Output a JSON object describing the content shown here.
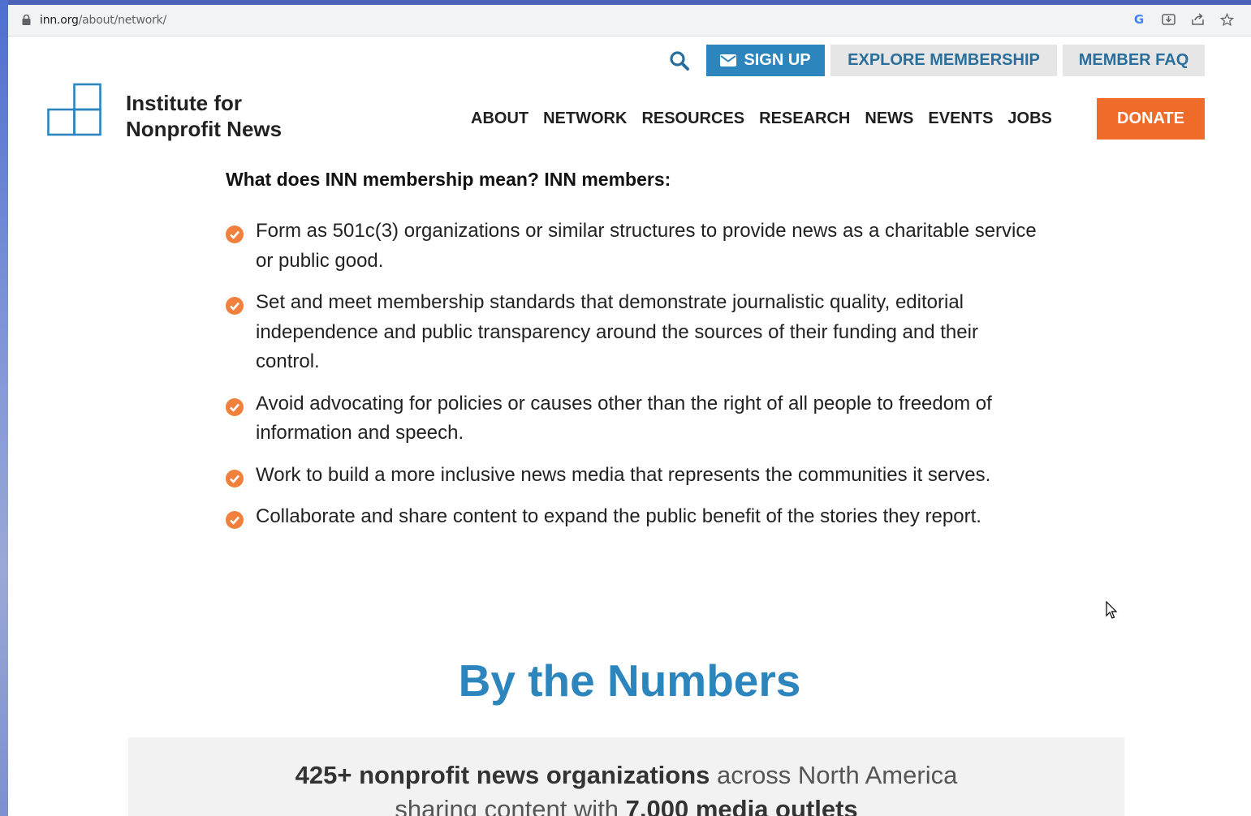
{
  "browser": {
    "url_domain": "inn.org",
    "url_path": "/about/network/"
  },
  "utility_nav": {
    "signup_label": "SIGN UP",
    "explore_label": "EXPLORE MEMBERSHIP",
    "faq_label": "MEMBER FAQ"
  },
  "logo": {
    "line1": "Institute for",
    "line2": "Nonprofit News"
  },
  "main_nav": {
    "items": [
      "ABOUT",
      "NETWORK",
      "RESOURCES",
      "RESEARCH",
      "NEWS",
      "EVENTS",
      "JOBS"
    ],
    "donate_label": "DONATE"
  },
  "membership": {
    "intro": "What does INN membership mean? INN members:",
    "items": [
      "Form as 501c(3) organizations or similar structures to provide news as a charitable service or public good.",
      "Set and meet membership standards that demonstrate journalistic quality, editorial independence and public transparency around the sources of their funding and their control.",
      "Avoid advocating for policies or causes other than the right of all people to freedom of information and speech.",
      "Work to build a more inclusive news media that represents the communities it serves.",
      "Collaborate and share content to expand the public benefit of the stories they report."
    ]
  },
  "numbers": {
    "title": "By the Numbers",
    "bold1": "425+ nonprofit news organizations",
    "text1": " across North America",
    "text2": "sharing content with ",
    "bold2": "7,000 media outlets"
  },
  "colors": {
    "accent_blue": "#2c85bd",
    "donate_orange": "#ef6b2a",
    "check_orange": "#f0803c"
  },
  "icons": [
    "lock-icon",
    "google-icon",
    "download-icon",
    "share-icon",
    "star-icon",
    "search-icon",
    "envelope-icon",
    "check-icon",
    "cursor-icon"
  ]
}
